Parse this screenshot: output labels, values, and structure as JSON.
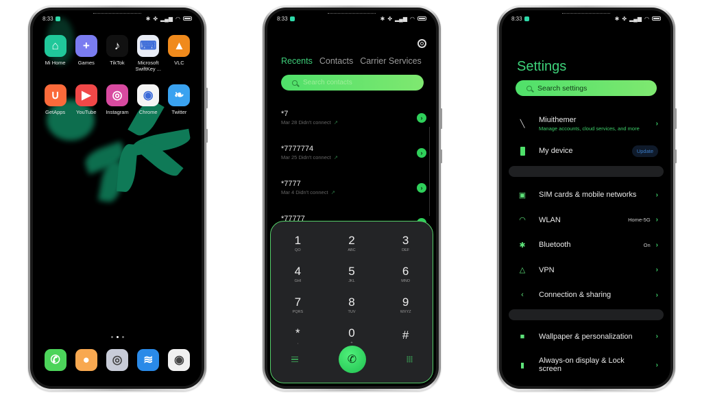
{
  "status_bar": {
    "time": "8:33",
    "icons": [
      "bluetooth-icon",
      "vibrate-icon",
      "signal-icon",
      "wifi-icon",
      "battery-icon"
    ],
    "icon_glyphs": "✱ ✤ ▐ ◠"
  },
  "home": {
    "apps_row1": [
      {
        "label": "Mi Home",
        "icon": "mihome-icon",
        "color": "#20c89a",
        "glyph": "⌂"
      },
      {
        "label": "Games",
        "icon": "games-icon",
        "color": "#7a7cf0",
        "glyph": "+"
      },
      {
        "label": "TikTok",
        "icon": "tiktok-icon",
        "color": "#111111",
        "glyph": "♪"
      },
      {
        "label": "Microsoft\nSwiftKey ...",
        "icon": "swiftkey-icon",
        "color": "#e8ecf5",
        "glyph": "⌨"
      },
      {
        "label": "VLC",
        "icon": "vlc-icon",
        "color": "#f08a1c",
        "glyph": "▲"
      }
    ],
    "apps_row2": [
      {
        "label": "GetApps",
        "icon": "getapps-icon",
        "color": "#fb6a3a",
        "glyph": "∪"
      },
      {
        "label": "YouTube",
        "icon": "youtube-icon",
        "color": "#f04848",
        "glyph": "▶"
      },
      {
        "label": "Instagram",
        "icon": "instagram-icon",
        "color": "#d84aa0",
        "glyph": "◎"
      },
      {
        "label": "Chrome",
        "icon": "chrome-icon",
        "color": "#f5f5f5",
        "glyph": "◉"
      },
      {
        "label": "Twitter",
        "icon": "twitter-icon",
        "color": "#3aa2f0",
        "glyph": "❧"
      }
    ],
    "dock": [
      {
        "icon": "phone-app-icon",
        "color": "#4cd45a",
        "glyph": "✆"
      },
      {
        "icon": "messages-app-icon",
        "color": "#f8a850",
        "glyph": "●"
      },
      {
        "icon": "security-app-icon",
        "color": "#c8ccd8",
        "glyph": "◎"
      },
      {
        "icon": "browser-app-icon",
        "color": "#2a8ae8",
        "glyph": "≋"
      },
      {
        "icon": "camera-app-icon",
        "color": "#f0f0f0",
        "glyph": "◉"
      }
    ],
    "page_count": 3,
    "current_page": 2
  },
  "dialer": {
    "tabs": [
      {
        "label": "Recents",
        "active": true
      },
      {
        "label": "Contacts",
        "active": false
      },
      {
        "label": "Carrier Services",
        "active": false
      }
    ],
    "search_placeholder": "Search contacts",
    "calls": [
      {
        "number": "*7",
        "date": "Mar 28",
        "status": "Didn't connect"
      },
      {
        "number": "*7777774",
        "date": "Mar 25",
        "status": "Didn't connect"
      },
      {
        "number": "*7777",
        "date": "Mar 4",
        "status": "Didn't connect"
      },
      {
        "number": "*77777",
        "date": "",
        "status": ""
      }
    ],
    "keys": [
      {
        "digit": "1",
        "letters": "QO"
      },
      {
        "digit": "2",
        "letters": "ABC"
      },
      {
        "digit": "3",
        "letters": "DEF"
      },
      {
        "digit": "4",
        "letters": "GHI"
      },
      {
        "digit": "5",
        "letters": "JKL"
      },
      {
        "digit": "6",
        "letters": "MNO"
      },
      {
        "digit": "7",
        "letters": "PQRS"
      },
      {
        "digit": "8",
        "letters": "TUV"
      },
      {
        "digit": "9",
        "letters": "WXYZ"
      },
      {
        "digit": "*",
        "letters": ","
      },
      {
        "digit": "0",
        "letters": "+"
      },
      {
        "digit": "#",
        "letters": ""
      }
    ],
    "call_glyph": "✆"
  },
  "settings": {
    "title": "Settings",
    "search_placeholder": "Search settings",
    "account": {
      "label": "Miuithemer",
      "sub": "Manage accounts, cloud services, and more"
    },
    "device": {
      "label": "My device",
      "badge": "Update"
    },
    "group1": [
      {
        "label": "SIM cards & mobile networks",
        "value": "",
        "icon": "sim-card-icon",
        "glyph": "▣"
      },
      {
        "label": "WLAN",
        "value": "Home-5G",
        "icon": "wifi-icon",
        "glyph": "◠"
      },
      {
        "label": "Bluetooth",
        "value": "On",
        "icon": "bluetooth-icon",
        "glyph": "✱"
      },
      {
        "label": "VPN",
        "value": "",
        "icon": "vpn-icon",
        "glyph": "△"
      },
      {
        "label": "Connection & sharing",
        "value": "",
        "icon": "share-icon",
        "glyph": "‹"
      }
    ],
    "group2": [
      {
        "label": "Wallpaper & personalization",
        "value": "",
        "icon": "wallpaper-icon",
        "glyph": "■"
      },
      {
        "label": "Always-on display & Lock screen",
        "value": "",
        "icon": "lock-icon",
        "glyph": "▮"
      }
    ],
    "chevron": "›"
  }
}
